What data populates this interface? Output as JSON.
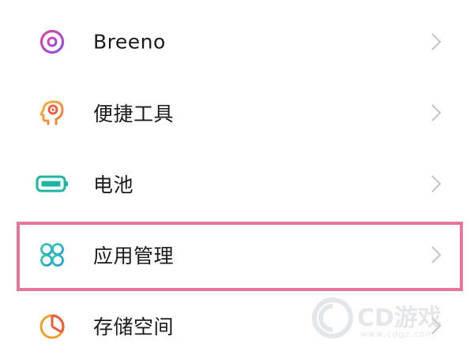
{
  "settings": {
    "items": [
      {
        "id": "breeno",
        "label": "Breeno",
        "icon": "breeno-icon",
        "icon_color": "#b44fd6"
      },
      {
        "id": "tools",
        "label": "便捷工具",
        "icon": "head-gear-icon",
        "icon_color": "#f0a030"
      },
      {
        "id": "battery",
        "label": "电池",
        "icon": "battery-icon",
        "icon_color": "#1fb5a0"
      },
      {
        "id": "apps",
        "label": "应用管理",
        "icon": "app-grid-icon",
        "icon_color": "#2fb8a0"
      },
      {
        "id": "storage",
        "label": "存储空间",
        "icon": "pie-chart-icon",
        "icon_color": "#f0a030"
      }
    ],
    "highlighted_item": "apps",
    "highlight_color": "#e8749d"
  },
  "watermark": {
    "brand": "CD游戏",
    "url": "www.cdgz.com"
  }
}
